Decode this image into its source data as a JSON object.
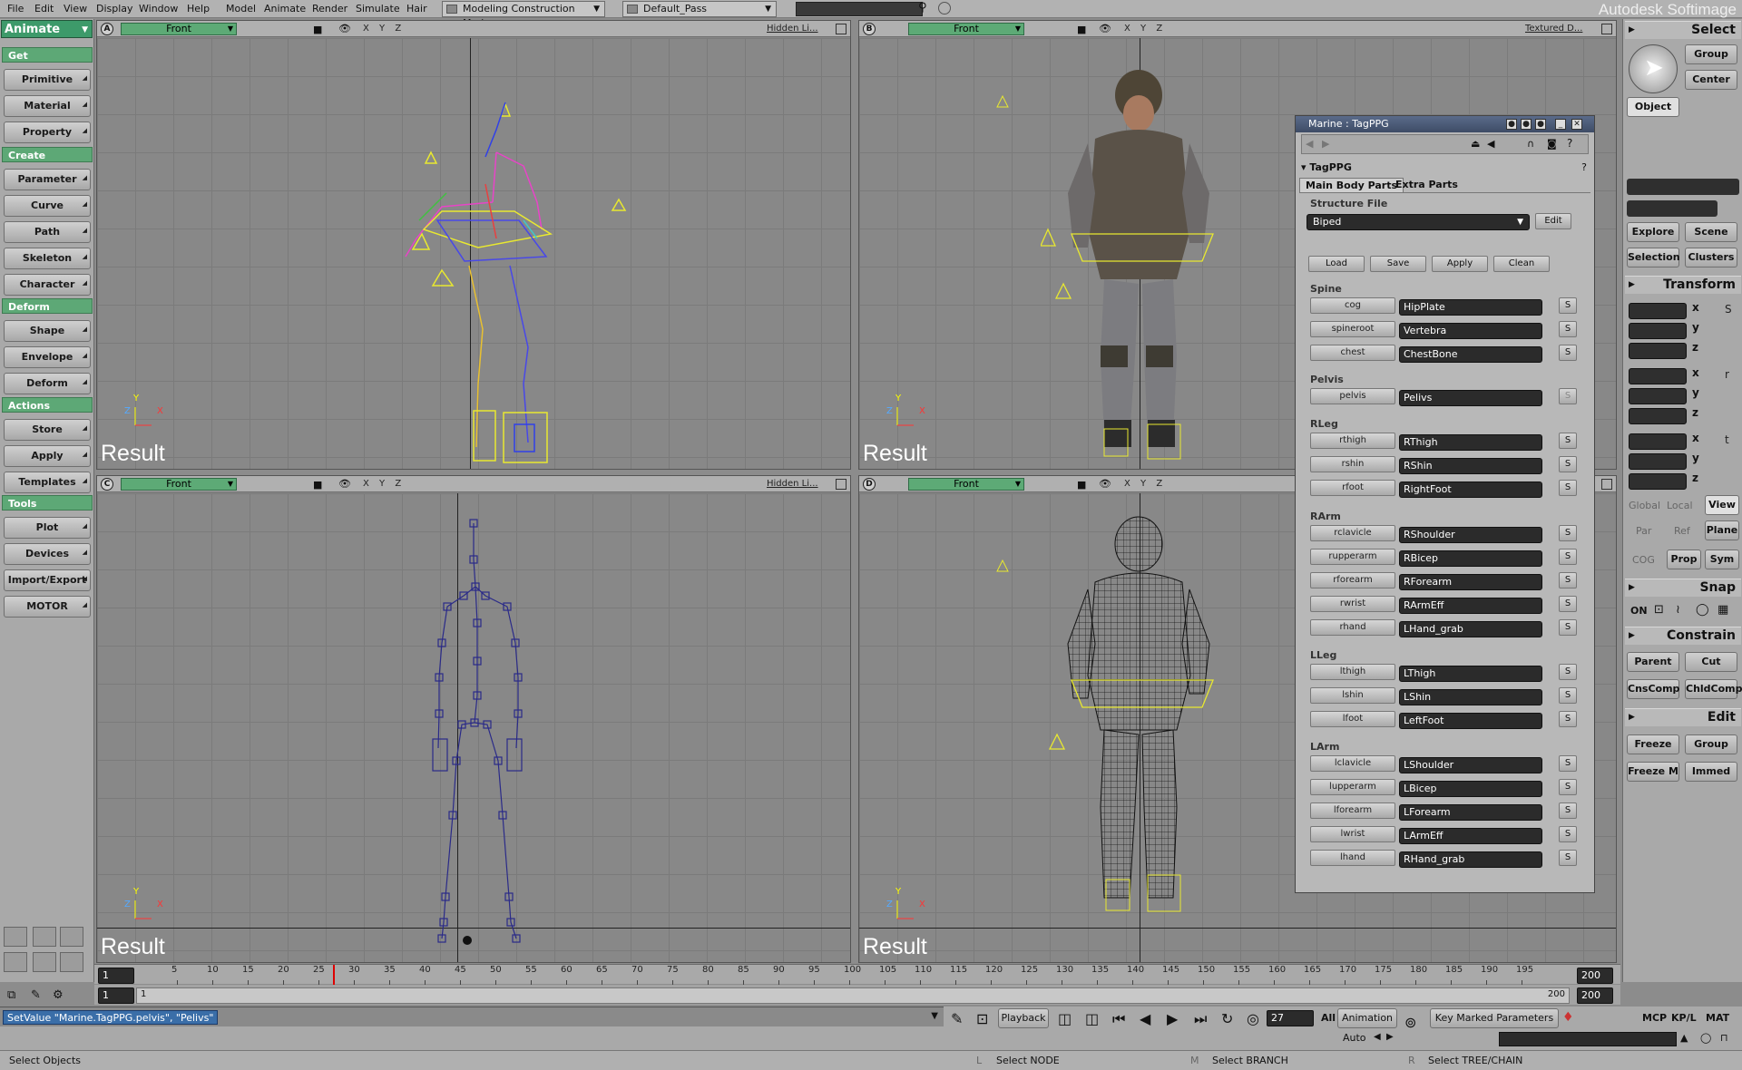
{
  "menubar": {
    "items": [
      "File",
      "Edit",
      "View",
      "Display",
      "Window",
      "Help",
      "Model",
      "Animate",
      "Render",
      "Simulate",
      "Hair"
    ],
    "construction_mode": "Modeling Construction Mode",
    "pass": "Default_Pass",
    "brand": "Autodesk Softimage"
  },
  "left_panel": {
    "mode": "Animate",
    "sections": [
      {
        "title": "Get",
        "buttons": [
          "Primitive",
          "Material",
          "Property"
        ]
      },
      {
        "title": "Create",
        "buttons": [
          "Parameter",
          "Curve",
          "Path",
          "Skeleton",
          "Character"
        ]
      },
      {
        "title": "Deform",
        "buttons": [
          "Shape",
          "Envelope",
          "Deform"
        ]
      },
      {
        "title": "Actions",
        "buttons": [
          "Store",
          "Apply",
          "Templates"
        ]
      },
      {
        "title": "Tools",
        "buttons": [
          "Plot",
          "Devices",
          "Import/Export",
          "MOTOR"
        ]
      }
    ]
  },
  "viewports": [
    {
      "letter": "A",
      "camera": "Front",
      "mode": "Hidden Li...",
      "axes": "X Y Z",
      "result": "Result"
    },
    {
      "letter": "B",
      "camera": "Front",
      "mode": "Textured D...",
      "axes": "X Y Z",
      "result": "Result"
    },
    {
      "letter": "C",
      "camera": "Front",
      "mode": "Hidden Li...",
      "axes": "X Y Z",
      "result": "Result"
    },
    {
      "letter": "D",
      "camera": "Front",
      "mode": "",
      "axes": "X Y Z",
      "result": "Result"
    }
  ],
  "axis_labels": {
    "y": "Y",
    "z": "Z",
    "x": "X"
  },
  "ppg": {
    "title": "Marine : TagPPG",
    "header": "TagPPG",
    "tabs": [
      "Main Body Parts",
      "Extra Parts"
    ],
    "structure_label": "Structure File",
    "structure_value": "Biped",
    "edit": "Edit",
    "actions": [
      "Load",
      "Save",
      "Apply",
      "Clean"
    ],
    "s_label": "S",
    "groups": [
      {
        "name": "Spine",
        "rows": [
          {
            "btn": "cog",
            "value": "HipPlate"
          },
          {
            "btn": "spineroot",
            "value": "Vertebra"
          },
          {
            "btn": "chest",
            "value": "ChestBone"
          }
        ]
      },
      {
        "name": "Pelvis",
        "rows": [
          {
            "btn": "pelvis",
            "value": "Pelivs"
          }
        ]
      },
      {
        "name": "RLeg",
        "rows": [
          {
            "btn": "rthigh",
            "value": "RThigh"
          },
          {
            "btn": "rshin",
            "value": "RShin"
          },
          {
            "btn": "rfoot",
            "value": "RightFoot"
          }
        ]
      },
      {
        "name": "RArm",
        "rows": [
          {
            "btn": "rclavicle",
            "value": "RShoulder"
          },
          {
            "btn": "rupperarm",
            "value": "RBicep"
          },
          {
            "btn": "rforearm",
            "value": "RForearm"
          },
          {
            "btn": "rwrist",
            "value": "RArmEff"
          },
          {
            "btn": "rhand",
            "value": "LHand_grab"
          }
        ]
      },
      {
        "name": "LLeg",
        "rows": [
          {
            "btn": "lthigh",
            "value": "LThigh"
          },
          {
            "btn": "lshin",
            "value": "LShin"
          },
          {
            "btn": "lfoot",
            "value": "LeftFoot"
          }
        ]
      },
      {
        "name": "LArm",
        "rows": [
          {
            "btn": "lclavicle",
            "value": "LShoulder"
          },
          {
            "btn": "lupperarm",
            "value": "LBicep"
          },
          {
            "btn": "lforearm",
            "value": "LForearm"
          },
          {
            "btn": "lwrist",
            "value": "LArmEff"
          },
          {
            "btn": "lhand",
            "value": "RHand_grab"
          }
        ]
      }
    ]
  },
  "right_panel": {
    "select": "Select",
    "group": "Group",
    "center": "Center",
    "object": "Object",
    "explore": "Explore",
    "scene": "Scene",
    "selection": "Selection",
    "clusters": "Clusters",
    "transform": "Transform",
    "axes": [
      "x",
      "y",
      "z"
    ],
    "global": "Global",
    "local": "Local",
    "view": "View",
    "par": "Par",
    "ref": "Ref",
    "plane": "Plane",
    "cog": "COG",
    "prop": "Prop",
    "sym": "Sym",
    "snap": "Snap",
    "on": "ON",
    "constrain": "Constrain",
    "parent": "Parent",
    "cut": "Cut",
    "cnscomp": "CnsComp",
    "chldcomp": "ChldComp",
    "edit": "Edit",
    "freeze": "Freeze",
    "group2": "Group",
    "freezem": "Freeze M",
    "immed": "Immed"
  },
  "timeline": {
    "start": "1",
    "end": "200",
    "current_frame": 27,
    "ticks": [
      "5",
      "10",
      "15",
      "20",
      "25",
      "30",
      "35",
      "40",
      "45",
      "50",
      "55",
      "60",
      "65",
      "70",
      "75",
      "80",
      "85",
      "90",
      "95",
      "100",
      "105",
      "110",
      "115",
      "120",
      "125",
      "130",
      "135",
      "140",
      "145",
      "150",
      "155",
      "160",
      "165",
      "170",
      "175",
      "180",
      "185",
      "190",
      "195"
    ],
    "range_start": "1",
    "range_start2": "1",
    "range_end": "200",
    "range_end2": "200"
  },
  "bottom": {
    "command": "SetValue \"Marine.TagPPG.pelvis\", \"Pelivs\"",
    "playback": "Playback",
    "frame": "27",
    "all": "All",
    "animation": "Animation",
    "auto": "Auto",
    "key_marked": "Key Marked Parameters",
    "mcp": "MCP",
    "kpl": "KP/L",
    "mat": "MAT"
  },
  "status": {
    "left": "Select Objects",
    "l": "L",
    "l_text": "Select NODE",
    "m": "M",
    "m_text": "Select BRANCH",
    "r": "R",
    "r_text": "Select TREE/CHAIN"
  },
  "colors": {
    "accent_green": "#5da876",
    "field_dark": "#2b2b2b",
    "title_blue": "#3e4c66"
  }
}
